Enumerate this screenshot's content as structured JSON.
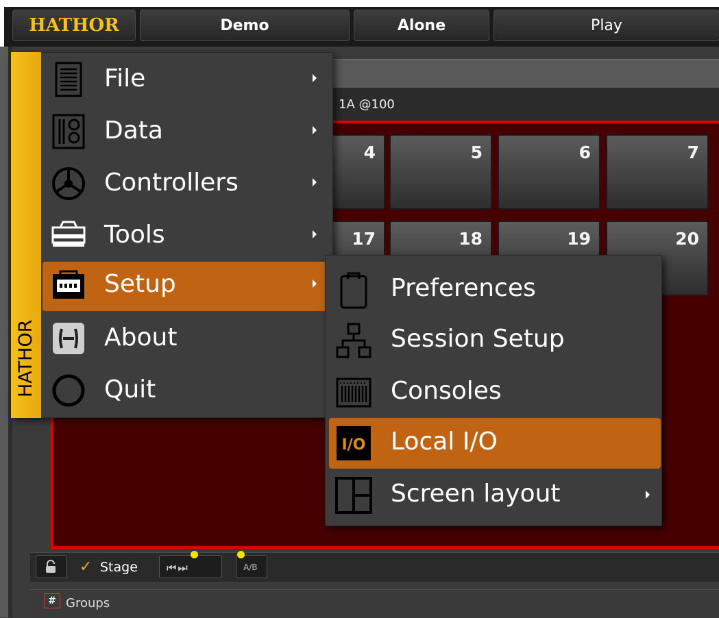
{
  "topbar": {
    "hathor_label": "HATHOR",
    "demo_label": "Demo",
    "alone_label": "Alone",
    "play_label": "Play"
  },
  "cue_bar": {
    "label": "1A @100"
  },
  "grid": {
    "row1": [
      "4",
      "5",
      "6",
      "7"
    ],
    "row2": [
      "17",
      "18",
      "19",
      "20"
    ]
  },
  "menu": {
    "tab_label": "HATHOR",
    "items": [
      {
        "label": "File",
        "icon": "document-lines-icon",
        "submenu": true
      },
      {
        "label": "Data",
        "icon": "data-columns-icon",
        "submenu": true
      },
      {
        "label": "Controllers",
        "icon": "steering-wheel-icon",
        "submenu": true
      },
      {
        "label": "Tools",
        "icon": "toolbox-icon",
        "submenu": true
      },
      {
        "label": "Setup",
        "icon": "console-box-icon",
        "submenu": true,
        "selected": true
      },
      {
        "label": "About",
        "icon": "hathor-logo-icon",
        "submenu": false
      },
      {
        "label": "Quit",
        "icon": "circle-icon",
        "submenu": false
      }
    ]
  },
  "submenu": {
    "items": [
      {
        "label": "Preferences",
        "icon": "clipboard-icon",
        "submenu": false
      },
      {
        "label": "Session Setup",
        "icon": "network-tree-icon",
        "submenu": false
      },
      {
        "label": "Consoles",
        "icon": "console-faders-icon",
        "submenu": false
      },
      {
        "label": "Local I/O",
        "icon": "io-icon",
        "icon_text": "I/O",
        "submenu": false,
        "selected": true
      },
      {
        "label": "Screen layout",
        "icon": "layout-grid-icon",
        "submenu": true
      }
    ]
  },
  "bottom_bar": {
    "stage_label": "Stage",
    "stage_checked": "✓",
    "transport_glyphs": "⏮⏭",
    "ab_label": "A/B"
  },
  "groups_bar": {
    "icon_text": "#",
    "label": "Groups"
  },
  "colors": {
    "accent": "#f4c017",
    "selection": "#c06414",
    "stage_border": "#e00000",
    "stage_bg": "#460000"
  }
}
